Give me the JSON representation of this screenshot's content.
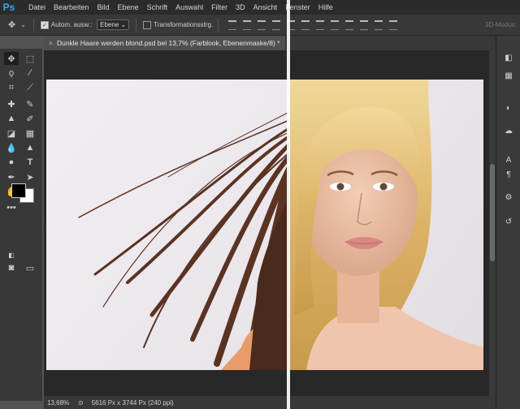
{
  "app": {
    "logo": "Ps"
  },
  "menu": [
    "Datei",
    "Bearbeiten",
    "Bild",
    "Ebene",
    "Schrift",
    "Auswahl",
    "Filter",
    "3D",
    "Ansicht",
    "Fenster",
    "Hilfe"
  ],
  "options": {
    "auto_select_label": "Autom. ausw.:",
    "auto_select_value": "Ebene",
    "transform_label": "Transformationsstrg.",
    "mode3d_label": "3D-Modus:"
  },
  "document": {
    "tab_title": "Dunkle Haare werden blond.psd bei 13,7% (Farblook, Ebenenmaske/8) *",
    "close_glyph": "×"
  },
  "status": {
    "zoom": "13,68%",
    "info": "5616 Px x 3744 Px (240 ppi)"
  },
  "colors": {
    "foreground": "#000000",
    "background": "#ffffff",
    "accent": "#31a8ff"
  },
  "icons": {
    "tools": [
      "move-icon",
      "marquee-icon",
      "lasso-icon",
      "magic-wand-icon",
      "crop-icon",
      "eyedropper-icon",
      "healing-brush-icon",
      "brush-icon",
      "clone-stamp-icon",
      "history-brush-icon",
      "eraser-icon",
      "gradient-icon",
      "blur-icon",
      "sharpen-icon",
      "dodge-icon",
      "type-icon",
      "pen-icon",
      "path-selection-icon",
      "hand-icon",
      "zoom-icon",
      "more-tools-icon"
    ],
    "panels": [
      "color-panel-icon",
      "swatches-panel-icon",
      "adjustments-panel-icon",
      "libraries-panel-icon",
      "character-panel-icon",
      "paragraph-panel-icon",
      "properties-panel-icon",
      "history-panel-icon"
    ]
  }
}
